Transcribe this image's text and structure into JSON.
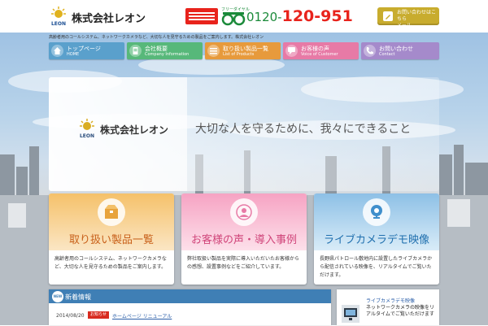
{
  "header": {
    "company_name": "株式会社レオン",
    "logo_text": "LEON",
    "freedial_caption": "フリーダイヤル",
    "phone_prefix": "0120-",
    "phone_number": "120-951",
    "mail_button_line1": "お問い合わせはこちら",
    "mail_button_line2": "メール"
  },
  "tagline": "高齢者用のコールシステム、ネットワークカメラなど、大切な人を見守るための製品をご案内します。株式会社レオン",
  "nav": [
    {
      "jp": "トップページ",
      "en": "HOME",
      "color": "#5aa0cc"
    },
    {
      "jp": "会社概要",
      "en": "Company Information",
      "color": "#57b87a"
    },
    {
      "jp": "取り扱い製品一覧",
      "en": "List of Products",
      "color": "#e79a3c"
    },
    {
      "jp": "お客様の声",
      "en": "Voice of Customer",
      "color": "#e77aa6"
    },
    {
      "jp": "お問い合わせ",
      "en": "Contact",
      "color": "#a58acb"
    }
  ],
  "hero": {
    "company_name": "株式会社レオン",
    "logo_text": "LEON",
    "slogan": "大切な人を守るために、我々にできること"
  },
  "cards": [
    {
      "title": "取り扱い製品一覧",
      "desc": "高齢者用のコールシステム、ネットワークカメラなど、大切な人を見守るための製品をご案内します。",
      "gradient_from": "#f5c16a",
      "gradient_to": "#fbe6c4",
      "title_color": "#c8601a"
    },
    {
      "title": "お客様の声・導入事例",
      "desc": "弊社取扱い製品を実際に導入いただいたお客様からの感想、設置事例などをご紹介しています。",
      "gradient_from": "#f6a3c3",
      "gradient_to": "#fde0ea",
      "title_color": "#d0457a"
    },
    {
      "title": "ライブカメラデモ映像",
      "desc": "長野県パトロール敷地内に設置したライブカメラから配信されている映像を、リアルタイムでご覧いただけます。",
      "gradient_from": "#8dc0e6",
      "gradient_to": "#d9ecf8",
      "title_color": "#1f6fae"
    }
  ],
  "news": {
    "badge": "NEW",
    "heading": "新着情報",
    "items": [
      {
        "date": "2014/08/20",
        "category": "お知らせ",
        "title": "ホームページ リニューアル"
      }
    ]
  },
  "side_banner": {
    "title": "ライブカメラデモ映像",
    "text": "ネットワークカメラの映像をリアルタイムでご覧いただけます"
  }
}
